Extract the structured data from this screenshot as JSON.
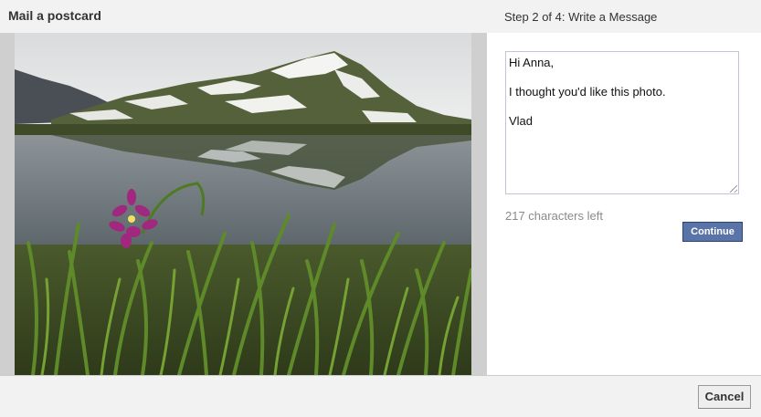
{
  "header": {
    "title": "Mail a postcard",
    "step": "Step 2 of 4: Write a Message"
  },
  "photo": {
    "subject": "mountain-lake-with-purple-flower"
  },
  "message": {
    "lines": [
      "Hi Anna,",
      "I thought you'd like this photo.",
      "Vlad"
    ],
    "chars_left": "217 characters left",
    "continue_label": "Continue"
  },
  "footer": {
    "cancel_label": "Cancel"
  },
  "colors": {
    "header_bg": "#f2f2f2",
    "primary_button": "#5b74a8",
    "muted_text": "#8a8a8a"
  }
}
